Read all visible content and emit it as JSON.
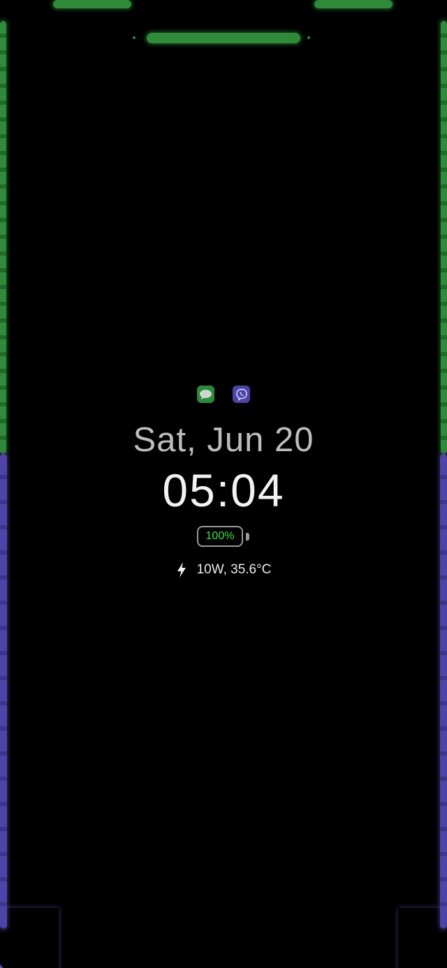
{
  "colors": {
    "background": "#000000",
    "edge_green": "#2f8a3a",
    "edge_purple": "#4e44a8",
    "date_text": "#bdbdbd",
    "time_text": "#f2f2f2",
    "battery_percent_text": "#3fe04a",
    "battery_outline": "#9a9a9a"
  },
  "notifications": [
    {
      "app": "Messages",
      "icon": "message-bubble-icon",
      "color": "#2c8a3a"
    },
    {
      "app": "Viber",
      "icon": "viber-phone-icon",
      "color": "#4e44a8"
    }
  ],
  "clock": {
    "date": "Sat, Jun 20",
    "time": "05:04"
  },
  "battery": {
    "level_percent": 100,
    "label": "100%"
  },
  "charging": {
    "icon": "lightning-bolt-icon",
    "info": "10W, 35.6°C"
  }
}
